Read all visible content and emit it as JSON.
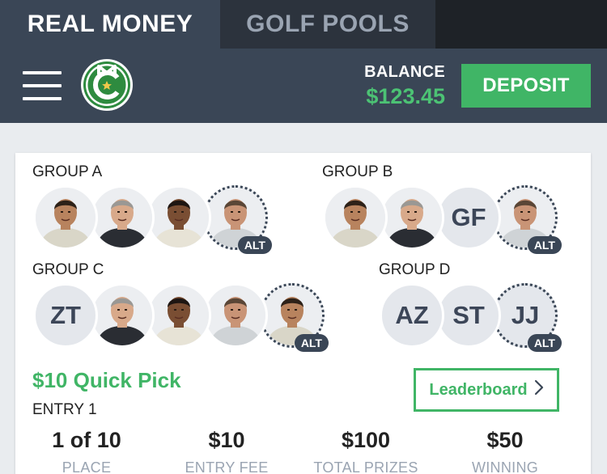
{
  "tabs": [
    {
      "label": "REAL MONEY",
      "active": true
    },
    {
      "label": "GOLF POOLS",
      "active": false
    }
  ],
  "header": {
    "menu_icon": "hamburger-menu-icon",
    "logo_letters": "MC",
    "balance_label": "BALANCE",
    "balance_value": "$123.45",
    "deposit_label": "DEPOSIT"
  },
  "colors": {
    "accent_green": "#40b566",
    "balance_green": "#4cc274",
    "header_bg": "#3a4656",
    "tab_dark": "#2c333d"
  },
  "groups": [
    {
      "label": "GROUP A",
      "picks": [
        {
          "type": "photo",
          "player": "player-a",
          "alt": false
        },
        {
          "type": "photo",
          "player": "player-b",
          "alt": false
        },
        {
          "type": "photo",
          "player": "player-c",
          "alt": false
        },
        {
          "type": "photo",
          "player": "player-d",
          "alt": true
        }
      ]
    },
    {
      "label": "GROUP B",
      "picks": [
        {
          "type": "photo",
          "player": "player-a",
          "alt": false
        },
        {
          "type": "photo",
          "player": "player-b",
          "alt": false
        },
        {
          "type": "initials",
          "initials": "GF",
          "alt": false
        },
        {
          "type": "photo",
          "player": "player-d",
          "alt": true
        }
      ]
    },
    {
      "label": "GROUP C",
      "picks": [
        {
          "type": "initials",
          "initials": "ZT",
          "alt": false
        },
        {
          "type": "photo",
          "player": "player-b",
          "alt": false
        },
        {
          "type": "photo",
          "player": "player-c",
          "alt": false
        },
        {
          "type": "photo",
          "player": "player-d",
          "alt": false
        },
        {
          "type": "photo",
          "player": "player-a",
          "alt": true
        }
      ]
    },
    {
      "label": "GROUP D",
      "picks": [
        {
          "type": "initials",
          "initials": "AZ",
          "alt": false
        },
        {
          "type": "initials",
          "initials": "ST",
          "alt": false
        },
        {
          "type": "initials",
          "initials": "JJ",
          "alt": true
        }
      ]
    }
  ],
  "alt_badge": "ALT",
  "entry": {
    "title": "$10 Quick Pick",
    "entry_label": "ENTRY 1",
    "leaderboard_label": "Leaderboard",
    "stats": [
      {
        "value": "1 of 10",
        "label": "PLACE"
      },
      {
        "value": "$10",
        "label": "ENTRY FEE"
      },
      {
        "value": "$100",
        "label": "TOTAL PRIZES"
      },
      {
        "value": "$50",
        "label": "WINNING"
      }
    ]
  }
}
